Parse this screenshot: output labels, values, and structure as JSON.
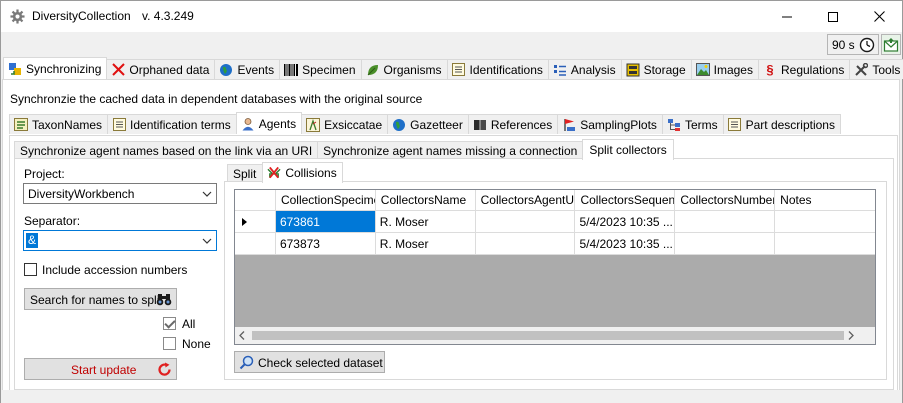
{
  "window": {
    "title": "DiversityCollection",
    "version": "v. 4.3.249"
  },
  "window_controls": {
    "minimize_icon": "minimize-icon",
    "maximize_icon": "maximize-icon",
    "close_icon": "close-icon"
  },
  "toolbar": {
    "timer_label": "90 s",
    "timer_icon": "clock-icon",
    "feedback_icon": "feedback-icon"
  },
  "main_tabs": [
    {
      "label": "Synchronizing",
      "icon": "sync-icon",
      "active": true
    },
    {
      "label": "Orphaned data",
      "icon": "red-x-icon",
      "active": false
    },
    {
      "label": "Events",
      "icon": "globe-icon",
      "active": false
    },
    {
      "label": "Specimen",
      "icon": "barcode-icon",
      "active": false
    },
    {
      "label": "Organisms",
      "icon": "leaf-icon",
      "active": false
    },
    {
      "label": "Identifications",
      "icon": "list-icon",
      "active": false
    },
    {
      "label": "Analysis",
      "icon": "analysis-icon",
      "active": false
    },
    {
      "label": "Storage",
      "icon": "storage-icon",
      "active": false
    },
    {
      "label": "Images",
      "icon": "image-icon",
      "active": false
    },
    {
      "label": "Regulations",
      "icon": "paragraph-icon",
      "active": false
    },
    {
      "label": "Tools",
      "icon": "tools-icon",
      "active": false
    }
  ],
  "description": "Synchronzie the cached data in dependent databases with the original source",
  "sub_tabs": [
    {
      "label": "TaxonNames",
      "icon": "taxon-icon",
      "active": false
    },
    {
      "label": "Identification terms",
      "icon": "list-icon",
      "active": false
    },
    {
      "label": "Agents",
      "icon": "agent-icon",
      "active": true
    },
    {
      "label": "Exsiccatae",
      "icon": "exsiccatae-icon",
      "active": false
    },
    {
      "label": "Gazetteer",
      "icon": "globe-icon",
      "active": false
    },
    {
      "label": "References",
      "icon": "book-icon",
      "active": false
    },
    {
      "label": "SamplingPlots",
      "icon": "sampling-icon",
      "active": false
    },
    {
      "label": "Terms",
      "icon": "terms-icon",
      "active": false
    },
    {
      "label": "Part descriptions",
      "icon": "list-icon",
      "active": false
    }
  ],
  "agent_tabs": [
    {
      "label": "Synchronize agent names based on the link via an URI",
      "active": false
    },
    {
      "label": "Synchronize agent names missing a connection",
      "active": false
    },
    {
      "label": "Split collectors",
      "active": true
    }
  ],
  "left_panel": {
    "project_label": "Project:",
    "project_value": "DiversityWorkbench",
    "separator_label": "Separator:",
    "separator_value": "&",
    "include_accession_label": "Include accession numbers",
    "include_accession_checked": false,
    "search_button": "Search for names to split",
    "search_icon": "binoculars-icon",
    "all_label": "All",
    "all_checked": true,
    "none_label": "None",
    "none_checked": false,
    "start_button": "Start update",
    "start_icon": "refresh-icon"
  },
  "split_tabs": [
    {
      "label": "Split",
      "active": false
    },
    {
      "label": "Collisions",
      "icon": "collision-icon",
      "active": true
    }
  ],
  "grid": {
    "columns": [
      "CollectionSpecimenID",
      "CollectorsName",
      "CollectorsAgentURI",
      "CollectorsSequence",
      "CollectorsNumber",
      "Notes"
    ],
    "rows": [
      {
        "CollectionSpecimenID": "673861",
        "CollectorsName": "R. Moser",
        "CollectorsAgentURI": "",
        "CollectorsSequence": "5/4/2023 10:35 ...",
        "CollectorsNumber": "",
        "Notes": "",
        "current": true
      },
      {
        "CollectionSpecimenID": "673873",
        "CollectorsName": "R. Moser",
        "CollectorsAgentURI": "",
        "CollectorsSequence": "5/4/2023 10:35 ...",
        "CollectorsNumber": "",
        "Notes": "",
        "current": false
      }
    ]
  },
  "check_button": "Check selected dataset",
  "check_icon": "magnifier-icon",
  "colors": {
    "selection": "#0078d7",
    "grid_background": "#ababab",
    "panel_background": "#f0f0f0"
  }
}
